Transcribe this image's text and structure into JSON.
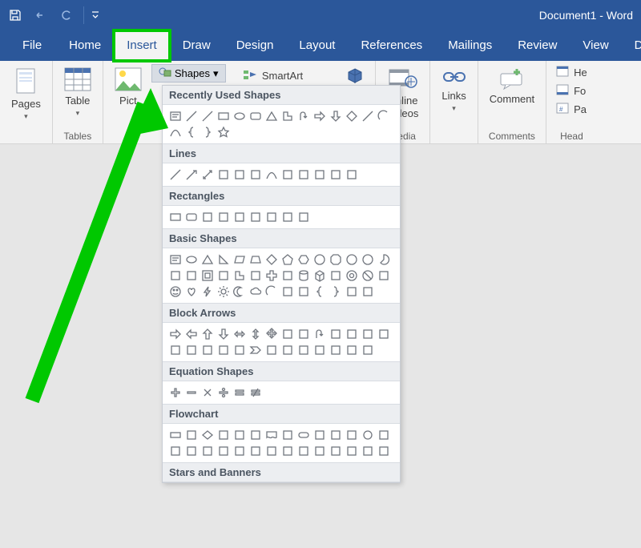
{
  "title": "Document1 - Word",
  "qat": {
    "save": "Save",
    "undo": "Undo",
    "redo": "Redo",
    "customize": "Customize Quick Access Toolbar"
  },
  "tabs": {
    "file": "File",
    "home": "Home",
    "insert": "Insert",
    "draw": "Draw",
    "design": "Design",
    "layout": "Layout",
    "references": "References",
    "mailings": "Mailings",
    "review": "Review",
    "view": "View",
    "developer": "Dev"
  },
  "ribbon": {
    "pages": {
      "label": "Pages",
      "group": ""
    },
    "tables": {
      "label": "Table",
      "group": "Tables"
    },
    "illustrations": {
      "pictures": "Pict",
      "shapes": "Shapes",
      "smartart": "SmartArt",
      "model3d": "3D Models"
    },
    "media": {
      "online_videos": "Online\nVideos",
      "group": "Media"
    },
    "links": {
      "label": "Links",
      "group": ""
    },
    "comments": {
      "label": "Comment",
      "group": "Comments"
    },
    "header_footer": {
      "header": "He",
      "footer": "Fo",
      "page_number": "Pa",
      "group": "Head"
    }
  },
  "shapes_panel": {
    "categories": {
      "recent": "Recently Used Shapes",
      "lines": "Lines",
      "rectangles": "Rectangles",
      "basic": "Basic Shapes",
      "block_arrows": "Block Arrows",
      "equation": "Equation Shapes",
      "flowchart": "Flowchart",
      "stars": "Stars and Banners"
    },
    "recent_shapes": [
      "text-box",
      "line",
      "line",
      "rectangle",
      "oval",
      "rounded-rect",
      "triangle",
      "l-shape",
      "u-turn-arrow",
      "right-arrow",
      "down-arrow",
      "diamond",
      "line",
      "arc",
      "curve",
      "left-brace",
      "right-brace",
      "star"
    ],
    "lines_shapes": [
      "line",
      "line-arrow",
      "line-double-arrow",
      "elbow",
      "elbow-arrow",
      "elbow-double-arrow",
      "curve",
      "curve-arrow",
      "curve-double-arrow",
      "freeform",
      "scribble",
      "freeform-closed"
    ],
    "rectangles_shapes": [
      "rectangle",
      "rounded-rect",
      "snip-single",
      "snip-same-side",
      "snip-diagonal",
      "round-single",
      "round-same-side",
      "round-diagonal",
      "round-snip"
    ],
    "basic_shapes": [
      "text-box",
      "oval",
      "triangle",
      "right-triangle",
      "parallelogram",
      "trapezoid",
      "diamond",
      "pentagon",
      "hexagon",
      "heptagon",
      "octagon",
      "decagon",
      "dodecagon",
      "pie",
      "chord",
      "teardrop",
      "frame",
      "half-frame",
      "l-shape",
      "diagonal-stripe",
      "cross",
      "plaque",
      "can",
      "cube",
      "bevel",
      "donut",
      "no-symbol",
      "block-arc",
      "smiley",
      "heart",
      "lightning",
      "sun",
      "moon",
      "cloud",
      "arc",
      "left-bracket",
      "right-bracket",
      "left-brace",
      "right-brace",
      "brace-pair",
      "brace-pair-2"
    ],
    "block_arrows_shapes": [
      "right-arrow",
      "left-arrow",
      "up-arrow",
      "down-arrow",
      "left-right-arrow",
      "up-down-arrow",
      "quad-arrow",
      "left-right-up-arrow",
      "bent-arrow",
      "u-turn-arrow",
      "left-up-arrow",
      "bent-up-arrow",
      "curved-right-arrow",
      "curved-left-arrow",
      "curved-up-arrow",
      "curved-down-arrow",
      "striped-right-arrow",
      "notched-right-arrow",
      "pentagon-arrow",
      "chevron",
      "right-callout",
      "down-callout",
      "left-callout",
      "up-callout",
      "left-right-callout",
      "quad-callout",
      "circular-arrow"
    ],
    "equation_shapes": [
      "plus",
      "minus",
      "multiply",
      "divide",
      "equal",
      "not-equal"
    ],
    "flowchart_shapes": [
      "process",
      "alt-process",
      "decision",
      "data",
      "predefined",
      "internal-storage",
      "document",
      "multidocument",
      "terminator",
      "preparation",
      "manual-input",
      "manual-operation",
      "connector",
      "off-page",
      "card",
      "punched-tape",
      "summing",
      "or",
      "collate",
      "sort",
      "extract",
      "merge",
      "stored-data",
      "delay",
      "seq-access",
      "magnetic-disk",
      "direct-access",
      "display"
    ]
  }
}
